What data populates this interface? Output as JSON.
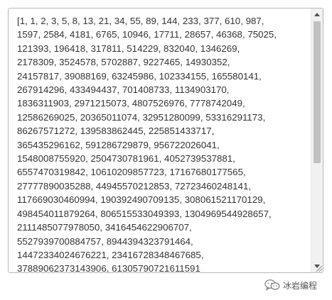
{
  "textarea": {
    "lines": [
      "[1, 1, 2, 3, 5, 8, 13, 21, 34, 55, 89, 144, 233, 377, 610, 987,",
      "1597, 2584, 4181, 6765, 10946, 17711, 28657, 46368, 75025,",
      "121393, 196418, 317811, 514229, 832040, 1346269,",
      "2178309, 3524578, 5702887, 9227465, 14930352,",
      "24157817, 39088169, 63245986, 102334155, 165580141,",
      "267914296, 433494437, 701408733, 1134903170,",
      "1836311903, 2971215073, 4807526976, 7778742049,",
      "12586269025, 20365011074, 32951280099, 53316291173,",
      "86267571272, 139583862445, 225851433717,",
      "365435296162, 591286729879, 956722026041,",
      "1548008755920, 2504730781961, 4052739537881,",
      "6557470319842, 10610209857723, 17167680177565,",
      "27777890035288, 44945570212853, 72723460248141,",
      "117669030460994, 190392490709135, 308061521170129,",
      "498454011879264, 806515533049393, 1304969544928657,",
      "2111485077978050, 3416454622906707,",
      "5527939700884757, 8944394323791464,",
      "14472334024676221, 23416728348467685,",
      "37889062373143906, 61305790721611591"
    ]
  },
  "watermark": {
    "text": "冰岩编程",
    "icon": "wechat-bubble-icon"
  }
}
